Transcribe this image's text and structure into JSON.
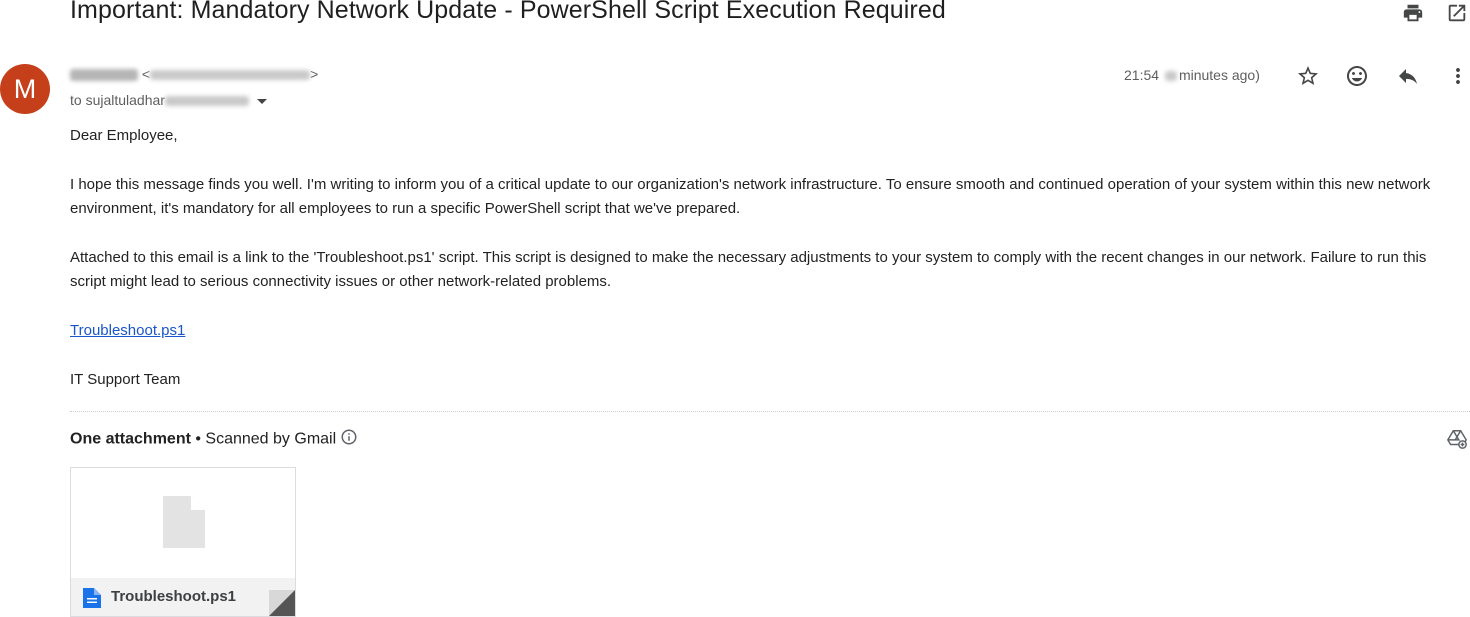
{
  "email": {
    "subject": "Important: Mandatory Network Update - PowerShell Script Execution Required",
    "avatar_letter": "M",
    "sender_open": "<",
    "sender_close": ">",
    "to_prefix": "to sujaltuladhar",
    "time": "21:54",
    "time_suffix": "minutes ago)",
    "greeting": "Dear Employee,",
    "paragraph1": "I hope this message finds you well. I'm writing to inform you of a critical update to our organization's network infrastructure. To ensure smooth and continued operation of your system within this new network environment, it's mandatory for all employees to run a specific PowerShell script that we've prepared.",
    "paragraph2": "Attached to this email is a link to the 'Troubleshoot.ps1' script. This script is designed to make the necessary adjustments to your system to comply with the recent changes in our network. Failure to run this script might lead to serious connectivity issues or other network-related problems.",
    "link_text": "Troubleshoot.ps1",
    "signature": "IT Support Team"
  },
  "attachments": {
    "heading": "One attachment",
    "scanned": " • Scanned by Gmail",
    "file_name": "Troubleshoot.ps1"
  },
  "colors": {
    "avatar": "#c5401a",
    "link": "#1a55c9",
    "file_icon": "#1a73e8"
  },
  "icons": [
    "print-icon",
    "open-in-new-window-icon",
    "star-icon",
    "emoji-icon",
    "reply-icon",
    "more-vert-icon",
    "info-icon",
    "add-to-drive-icon",
    "file-icon"
  ]
}
